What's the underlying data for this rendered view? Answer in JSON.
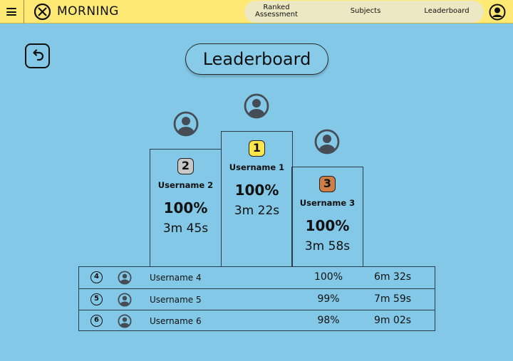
{
  "header": {
    "brand": "MORNING",
    "nav": {
      "ranked_line1": "Ranked",
      "ranked_line2": "Assessment",
      "subjects": "Subjects",
      "leaderboard": "Leaderboard"
    }
  },
  "page_title": "Leaderboard",
  "podium": {
    "first": {
      "rank": "1",
      "username": "Username 1",
      "score": "100%",
      "time": "3m 22s",
      "badge_color": "#fde54a"
    },
    "second": {
      "rank": "2",
      "username": "Username 2",
      "score": "100%",
      "time": "3m 45s",
      "badge_color": "#c8c8c8"
    },
    "third": {
      "rank": "3",
      "username": "Username 3",
      "score": "100%",
      "time": "3m 58s",
      "badge_color": "#cd7f45"
    }
  },
  "rows": [
    {
      "rank": "4",
      "username": "Username 4",
      "score": "100%",
      "time": "6m 32s"
    },
    {
      "rank": "5",
      "username": "Username 5",
      "score": "99%",
      "time": "7m 59s"
    },
    {
      "rank": "6",
      "username": "Username 6",
      "score": "98%",
      "time": "9m 02s"
    }
  ],
  "colors": {
    "background": "#83c8e6",
    "topbar": "#fde973",
    "nav_pill": "#ede8c4"
  },
  "icons": [
    "menu-icon",
    "logo-icon",
    "account-icon",
    "back-arrow-icon",
    "user-avatar-icon"
  ]
}
